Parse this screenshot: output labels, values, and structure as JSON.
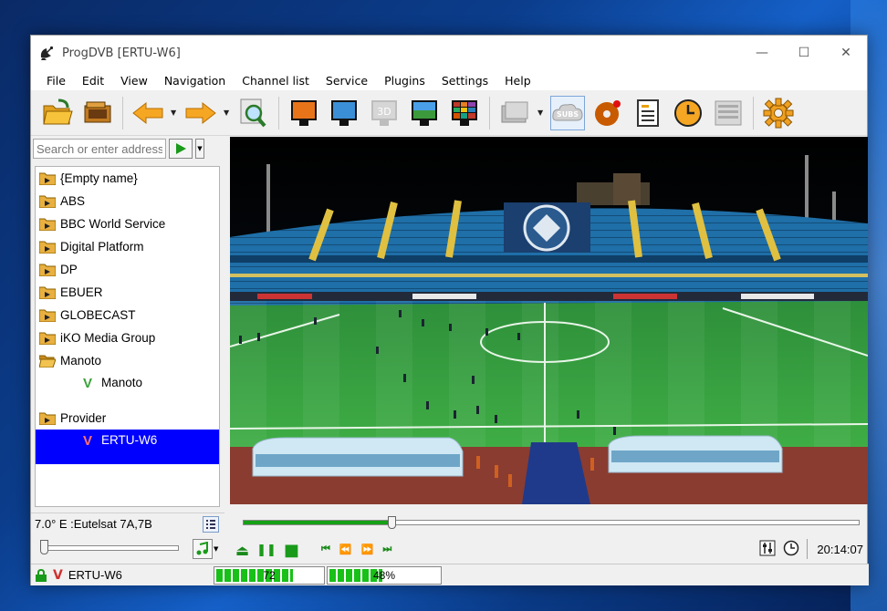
{
  "window": {
    "title": "ProgDVB [ERTU-W6]",
    "controls": {
      "minimize": "—",
      "maximize": "☐",
      "close": "✕"
    }
  },
  "menu": [
    "File",
    "Edit",
    "View",
    "Navigation",
    "Channel list",
    "Service",
    "Plugins",
    "Settings",
    "Help"
  ],
  "toolbar": {
    "subtitles_label": "SUBS",
    "three_d_label": "3D"
  },
  "address": {
    "placeholder": "Search or enter address"
  },
  "tree": {
    "items": [
      {
        "label": "{Empty name}",
        "type": "folder"
      },
      {
        "label": "ABS",
        "type": "folder"
      },
      {
        "label": "BBC World Service",
        "type": "folder"
      },
      {
        "label": "Digital Platform",
        "type": "folder"
      },
      {
        "label": "DP",
        "type": "folder"
      },
      {
        "label": "EBUER",
        "type": "folder"
      },
      {
        "label": "GLOBECAST",
        "type": "folder"
      },
      {
        "label": "iKO Media Group",
        "type": "folder"
      },
      {
        "label": "Manoto",
        "type": "folder-open"
      },
      {
        "label": "Manoto",
        "type": "channel"
      },
      {
        "label": "Provider",
        "type": "folder"
      },
      {
        "label": "ERTU-W6",
        "type": "channel-selected"
      }
    ],
    "channel_glyph": "V"
  },
  "status": {
    "satellite": "7.0° E :Eutelsat 7A,7B",
    "clock": "20:14:07",
    "channel": "ERTU-W6",
    "signal_level": "72",
    "signal_fraction": 0.72,
    "quality_level": "48%",
    "quality_fraction": 0.48
  },
  "playback": {
    "seek_fraction": 0.24,
    "volume_fraction": 0.0,
    "play_glyphs": {
      "eject": "⏏",
      "pause": "❚❚",
      "stop": "■"
    },
    "seek_glyphs": {
      "prev": "⏮",
      "rewind": "⏪",
      "forward": "⏩",
      "next": "⏭"
    }
  },
  "colors": {
    "selection": "#0000ff",
    "progress": "#16a016",
    "signal": "#18c018"
  }
}
